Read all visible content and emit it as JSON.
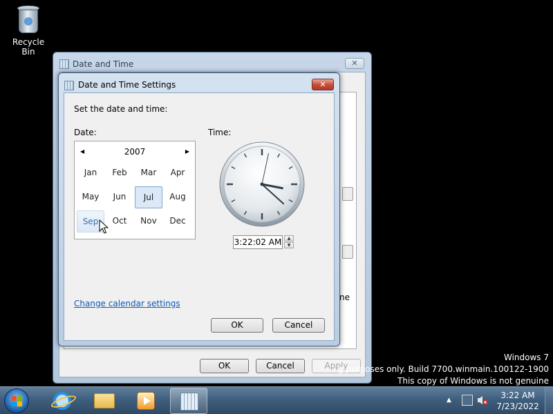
{
  "desktop": {
    "recycle_bin_label": "Recycle Bin",
    "watermark": {
      "line1": "Windows 7",
      "line2": "g purposes only. Build 7700.winmain.100122-1900",
      "line3": "This copy of Windows is not genuine"
    }
  },
  "back_window": {
    "title": "Date and Time",
    "close_glyph": "✕",
    "ok_label": "OK",
    "cancel_label": "Cancel",
    "apply_label": "Apply",
    "partial_text": "ne"
  },
  "dialog": {
    "title": "Date and Time Settings",
    "close_glyph": "✕",
    "instruction": "Set the date and time:",
    "date_label": "Date:",
    "time_label": "Time:",
    "calendar": {
      "prev_glyph": "◀",
      "next_glyph": "▶",
      "year": "2007",
      "months": [
        "Jan",
        "Feb",
        "Mar",
        "Apr",
        "May",
        "Jun",
        "Jul",
        "Aug",
        "Sep",
        "Oct",
        "Nov",
        "Dec"
      ],
      "selected_month": "Jul",
      "hover_month": "Sep"
    },
    "time_value": "3:22:02 AM",
    "clock": {
      "hour": 3,
      "minute": 22,
      "second": 2
    },
    "change_calendar_link": "Change calendar settings",
    "ok_label": "OK",
    "cancel_label": "Cancel"
  },
  "taskbar": {
    "clock_time": "3:22 AM",
    "clock_date": "7/23/2022",
    "tray_arrow": "▲"
  }
}
